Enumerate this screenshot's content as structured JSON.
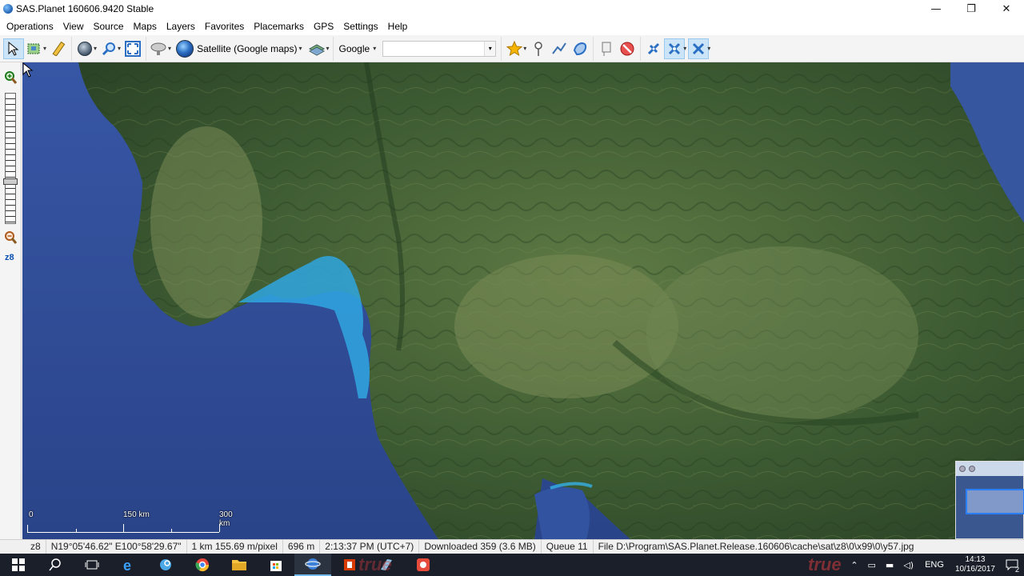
{
  "window": {
    "title": "SAS.Planet 160606.9420 Stable",
    "controls": {
      "minimize": "—",
      "maximize": "❐",
      "close": "✕"
    }
  },
  "menu": [
    "Operations",
    "View",
    "Source",
    "Maps",
    "Layers",
    "Favorites",
    "Placemarks",
    "GPS",
    "Settings",
    "Help"
  ],
  "toolbar": {
    "map_source_label": "Satellite (Google maps)",
    "search_engine": "Google",
    "search_value": "",
    "dropdown_arrow": "▾"
  },
  "zoom": {
    "level": "z8",
    "in_icon": "+",
    "out_icon": "−"
  },
  "scale": {
    "labels": [
      "0",
      "150 km",
      "300 km"
    ]
  },
  "status": {
    "zoom": "z8",
    "coords": "N19°05'46.62\" E100°58'29.67\"",
    "resolution": "1 km 155.69 m/pixel",
    "altitude": "696 m",
    "time": "2:13:37 PM (UTC+7)",
    "downloaded": "Downloaded 359 (3.6 MB)",
    "queue": "Queue 11",
    "file": "File D:\\Program\\SAS.Planet.Release.160606\\cache\\sat\\z8\\0\\x99\\0\\y57.jpg"
  },
  "taskbar": {
    "lang": "ENG",
    "time": "14:13",
    "date": "10/16/2017",
    "notifications": "2",
    "watermark": "true"
  },
  "colors": {
    "sea": "#2e4d93",
    "land_dark": "#2f4a2a",
    "land_light": "#5e7a45",
    "shallow_water": "#2fa6e0",
    "accent": "#0b4fb0"
  }
}
